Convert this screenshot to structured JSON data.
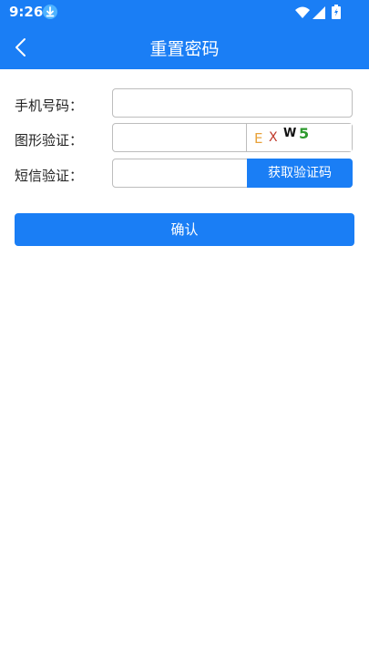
{
  "status_bar": {
    "time": "9:26",
    "icons": [
      "download-icon",
      "wifi-icon",
      "signal-icon",
      "battery-icon"
    ]
  },
  "header": {
    "title": "重置密码",
    "back_icon": "chevron-left-icon"
  },
  "form": {
    "phone": {
      "label": "手机号码：",
      "value": "",
      "placeholder": ""
    },
    "captcha": {
      "label": "图形验证：",
      "value": "",
      "placeholder": "",
      "image_chars": [
        {
          "char": "E",
          "color": "#e8a23a"
        },
        {
          "char": "X",
          "color": "#c0392b"
        },
        {
          "char": "W",
          "color": "#111111"
        },
        {
          "char": "5",
          "color": "#2e9a2e"
        }
      ]
    },
    "sms": {
      "label": "短信验证：",
      "value": "",
      "placeholder": "",
      "button_label": "获取验证码"
    }
  },
  "confirm_button": {
    "label": "确认"
  },
  "colors": {
    "accent": "#1a7ef5",
    "border": "#bdbdbd",
    "background": "#ffffff"
  }
}
